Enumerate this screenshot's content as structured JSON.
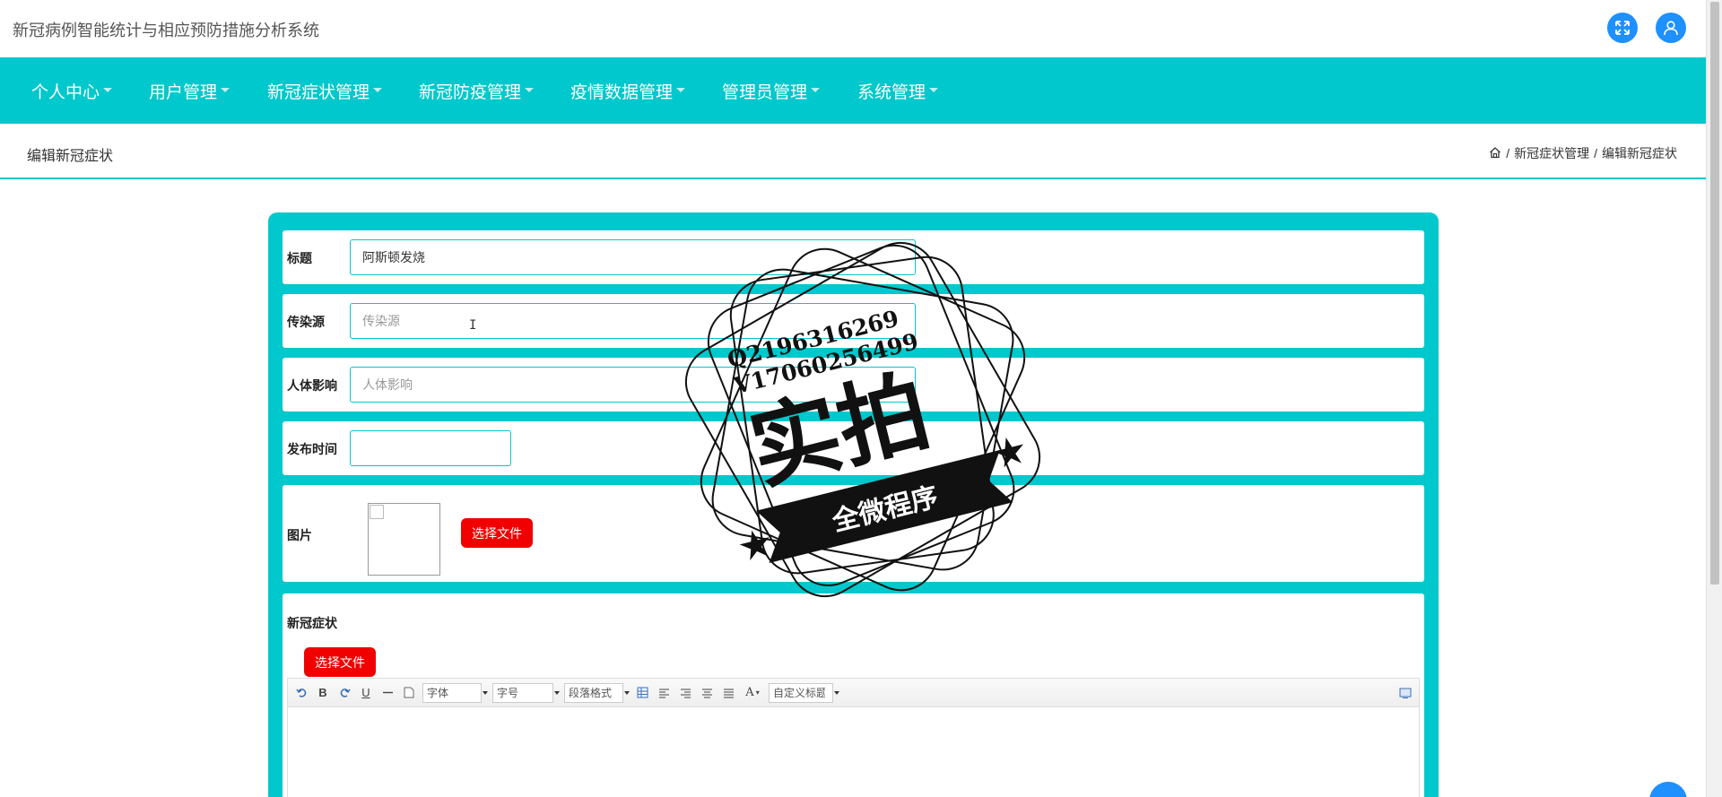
{
  "app": {
    "title": "新冠病例智能统计与相应预防措施分析系统"
  },
  "header": {
    "fullscreen_icon": "fullscreen-icon",
    "user_icon": "user-icon",
    "accent": "#1e90ff"
  },
  "nav": {
    "color": "#00c8cc",
    "items": [
      {
        "label": "个人中心"
      },
      {
        "label": "用户管理"
      },
      {
        "label": "新冠症状管理"
      },
      {
        "label": "新冠防疫管理"
      },
      {
        "label": "疫情数据管理"
      },
      {
        "label": "管理员管理"
      },
      {
        "label": "系统管理"
      }
    ]
  },
  "page": {
    "title": "编辑新冠症状",
    "breadcrumb": {
      "home_icon": "home-icon",
      "sep": "/",
      "level1": "新冠症状管理",
      "level2": "编辑新冠症状"
    }
  },
  "form": {
    "title_label": "标题",
    "title_value": "阿斯顿发烧",
    "source_label": "传染源",
    "source_placeholder": "传染源",
    "impact_label": "人体影响",
    "impact_placeholder": "人体影响",
    "time_label": "发布时间",
    "time_value": "",
    "image_label": "图片",
    "choose_file": "选择文件",
    "symptom_label": "新冠症状",
    "choose_file2": "选择文件"
  },
  "editor": {
    "font_family": "字体",
    "font_size": "字号",
    "paragraph": "段落格式",
    "custom_title": "自定义标题",
    "bold": "B",
    "underline": "U",
    "font_color": "A"
  },
  "watermark": {
    "line1": "Q2196316269",
    "line2": "V17060256499",
    "big": "实拍",
    "ribbon": "全微程序"
  }
}
